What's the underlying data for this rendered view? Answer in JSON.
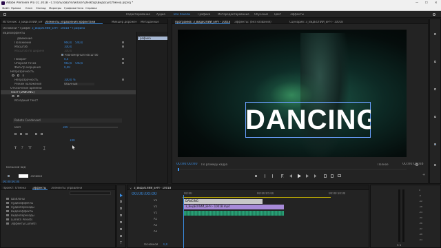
{
  "window": {
    "title": "Adobe Premiere Pro CC 2018 - C:\\Пользователи\\User\\Desktop\\Видосы\\Отмена.prproj *",
    "controls": [
      "—",
      "☐",
      "✕"
    ]
  },
  "menu": [
    "Файл",
    "Правка",
    "Клип",
    "Эпизод",
    "Маркеры",
    "Графика",
    "Окно",
    "Справка"
  ],
  "workspaces": [
    "Редактирование",
    "Аудио",
    "Все панели",
    "Графика",
    "Метаредактирование",
    "Обучение",
    "Цвет",
    "Эффекты"
  ],
  "source_tabs": [
    "Источник: 3_ВидЕОЛИЙ_ЕНЧ - 10018.mp4",
    "Элементы управления эффектами",
    "Микшер дорожек",
    "Метаданные"
  ],
  "effect_controls": {
    "breadcrumb": "Основной * Графика",
    "clip": "3_ВидЕОЛИЙ_ЕНЧ - 10018 * Графика",
    "section_video": "Видеоэффекты",
    "mini_timeline_clip": "Графика",
    "rows": [
      {
        "label": "Движение",
        "v1": "",
        "v2": ""
      },
      {
        "label": "Положение",
        "v1": "960,0",
        "v2": "540,0"
      },
      {
        "label": "Масштаб",
        "v1": "100,0",
        "v2": ""
      },
      {
        "label": "Масштаб по ширине",
        "v1": "100,0",
        "v2": ""
      },
      {
        "label": "",
        "v1": "Равномерный масштаб",
        "v2": ""
      },
      {
        "label": "Поворот",
        "v1": "0,0",
        "v2": ""
      },
      {
        "label": "Опорная точка",
        "v1": "960,0",
        "v2": "540,0"
      },
      {
        "label": "Фильтр мерцания",
        "v1": "0,00",
        "v2": ""
      },
      {
        "label": "Непрозрачность",
        "v1": "",
        "v2": ""
      },
      {
        "label": "Непрозрачность",
        "v1": "100,0 %",
        "v2": ""
      },
      {
        "label": "Режим наложения",
        "v1": "Обычный",
        "v2": ""
      },
      {
        "label": "Отключение времени",
        "v1": "",
        "v2": ""
      },
      {
        "label": "Текст (DANCING)",
        "v1": "",
        "v2": ""
      },
      {
        "label": "Исходный текст",
        "v1": "",
        "v2": ""
      }
    ],
    "font_name": "Roboto Condensed",
    "font_style": "Bold",
    "font_size": "300",
    "tracking": "100",
    "appearance_label": "Внешний вид",
    "fill_label": "Заливка",
    "timecode": "00:00:00:00"
  },
  "program": {
    "tabs": [
      "Программа: 3_ВидЕОЛИЙ_ЕНЧ - 10018",
      "Эффекты: (без названия)",
      "Сценарий: 3_ВидЕОЛИЙ_ЕНЧ - 10018"
    ],
    "overlay_text": "DANCING",
    "timecode_left": "00:00:00:00",
    "fit": "По размеру кадра",
    "quality": "Полное",
    "timecode_right": "00:00:08:08"
  },
  "project": {
    "tabs": [
      "Проект: Отмена",
      "Эффекты",
      "Элементы управления"
    ],
    "items": [
      "Шаблоны",
      "Аудиоэффекты",
      "Аудиопереходы",
      "Видеоэффекты",
      "Видеопереходы",
      "Lumetri Presets",
      "Эффекты Lumetri"
    ]
  },
  "timeline": {
    "tab": "3_ВидЕОЛИЙ_ЕНЧ - 10018",
    "timecode": "00:00:00:00",
    "ruler": [
      "00:00",
      "00:00:05:00",
      "00:00:10:00"
    ],
    "tracks": [
      "V3",
      "V2",
      "V1",
      "A1",
      "A2",
      "A3"
    ],
    "clip_text": "DANCING",
    "clip_video": "3_ВидЕОЛИЙ_ЕНЧ - 10018.mp4",
    "master": "Основной",
    "master_value": "0,0"
  },
  "meter": {
    "labels": [
      "0",
      "-6",
      "-12",
      "-18",
      "-24",
      "-30",
      "-36",
      "-42",
      "-48",
      "-54"
    ],
    "footer": "S  S"
  },
  "colors": {
    "accent": "#3b8fe6",
    "text_clip": "#c7c7c7",
    "video_clip": "#a78ad8",
    "audio_clip": "#2aa378",
    "playhead": "#3b8fe6"
  }
}
